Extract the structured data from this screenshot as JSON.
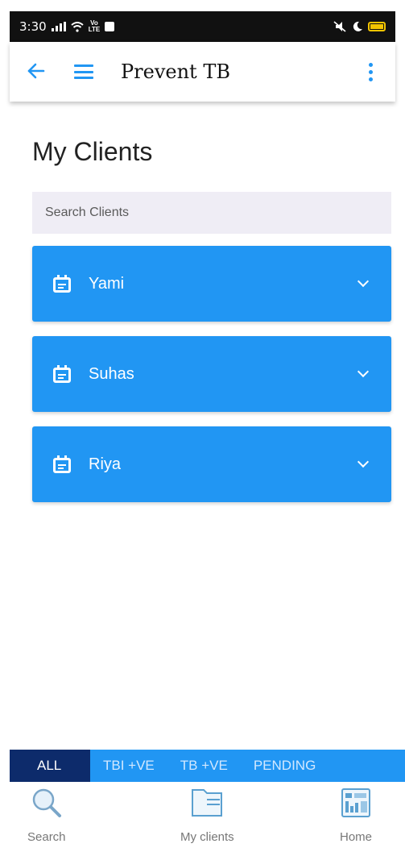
{
  "status_bar": {
    "time": "3:30"
  },
  "app_bar": {
    "title": "Prevent TB"
  },
  "page": {
    "heading": "My Clients"
  },
  "search": {
    "placeholder": "Search Clients"
  },
  "clients": [
    {
      "name": "Yami"
    },
    {
      "name": "Suhas"
    },
    {
      "name": "Riya"
    }
  ],
  "filters": {
    "all": "ALL",
    "tbi": "TBI +VE",
    "tb": "TB +VE",
    "pending": "PENDING",
    "active": "ALL"
  },
  "bottom_nav": {
    "search": "Search",
    "my_clients": "My clients",
    "home": "Home"
  },
  "colors": {
    "primary": "#2196f3",
    "active_tab": "#0d2b6b",
    "search_bg": "#efedf5"
  }
}
